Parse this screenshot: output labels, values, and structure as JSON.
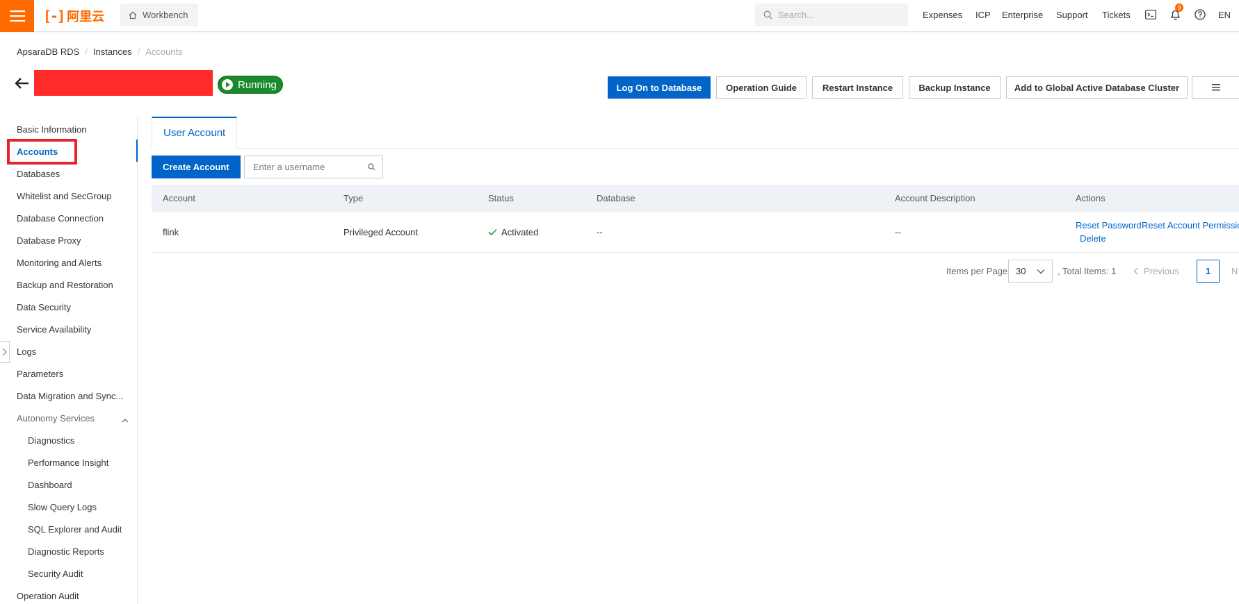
{
  "topbar": {
    "logo_text": "阿里云",
    "workbench_label": "Workbench",
    "search_placeholder": "Search...",
    "nav": [
      "Expenses",
      "ICP",
      "Enterprise",
      "Support",
      "Tickets"
    ],
    "notification_count": "9",
    "language": "EN"
  },
  "breadcrumb": [
    "ApsaraDB RDS",
    "Instances",
    "Accounts"
  ],
  "instance": {
    "status": "Running"
  },
  "actions": {
    "log_on": "Log On to Database",
    "guide": "Operation Guide",
    "restart": "Restart Instance",
    "backup": "Backup Instance",
    "global_cluster": "Add to Global Active Database Cluster"
  },
  "sidebar": {
    "items": [
      "Basic Information",
      "Accounts",
      "Databases",
      "Whitelist and SecGroup",
      "Database Connection",
      "Database Proxy",
      "Monitoring and Alerts",
      "Backup and Restoration",
      "Data Security",
      "Service Availability",
      "Logs",
      "Parameters",
      "Data Migration and Sync..."
    ],
    "group_label": "Autonomy Services",
    "sub_items": [
      "Diagnostics",
      "Performance Insight",
      "Dashboard",
      "Slow Query Logs",
      "SQL Explorer and Audit",
      "Diagnostic Reports",
      "Security Audit"
    ],
    "last_item": "Operation Audit"
  },
  "main": {
    "tab_label": "User Account",
    "create_button": "Create Account",
    "search_placeholder": "Enter a username",
    "table": {
      "columns": [
        "Account",
        "Type",
        "Status",
        "Database",
        "Account Description",
        "Actions"
      ],
      "rows": [
        {
          "account": "flink",
          "type": "Privileged Account",
          "status": "Activated",
          "database": "--",
          "description": "--",
          "actions": [
            "Reset Password",
            "Reset Account Permissio",
            "Delete"
          ]
        }
      ]
    },
    "pagination": {
      "items_per_page_label": "Items per Page",
      "page_size": "30",
      "total_label": ", Total Items: 1",
      "previous": "Previous",
      "current_page": "1",
      "next": "N"
    }
  },
  "colors": {
    "brand": "#ff6a00",
    "primary": "#0064c8",
    "running": "#1a8a2a",
    "highlight": "#e8232b"
  }
}
